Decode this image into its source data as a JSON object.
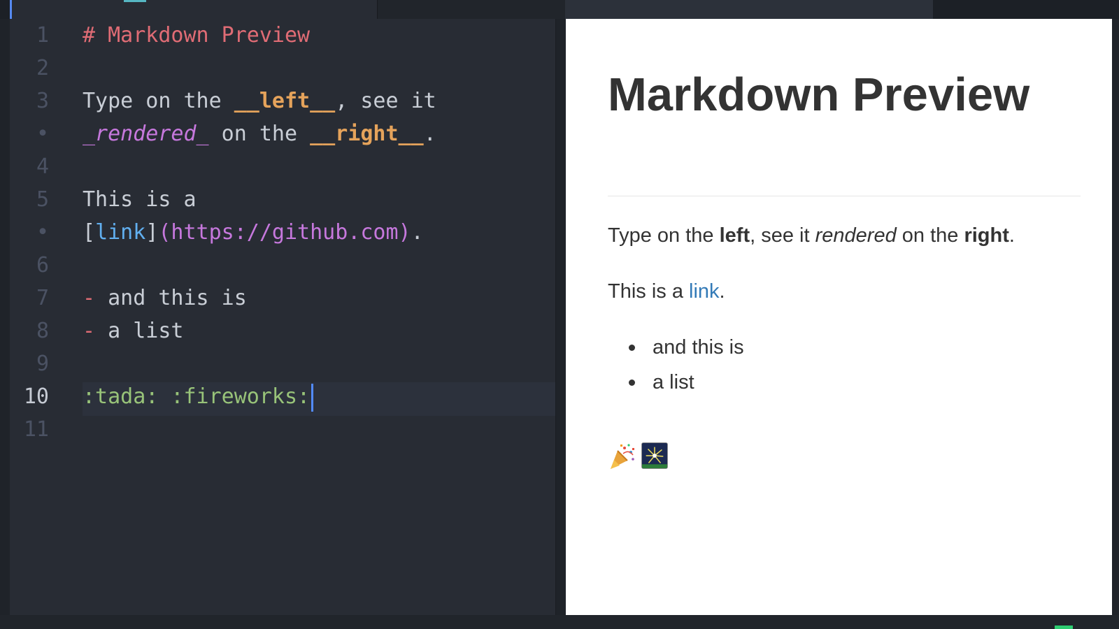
{
  "editor": {
    "lines": [
      {
        "number": "1",
        "text": "# Markdown Preview"
      },
      {
        "number": "2",
        "text": ""
      },
      {
        "number": "3",
        "text_a": "Type on the ",
        "bold_a": "__left__",
        "text_b": ", see it"
      },
      {
        "number": "•",
        "ital": "_rendered_",
        "text_a": " on the ",
        "bold_a": "__right__",
        "text_b": "."
      },
      {
        "number": "4",
        "text": ""
      },
      {
        "number": "5",
        "text": "This is a"
      },
      {
        "number": "•",
        "bracket_open": "[",
        "link_text": "link",
        "bracket_close": "]",
        "url": "(https://github.com)",
        "text_b": "."
      },
      {
        "number": "6",
        "text": ""
      },
      {
        "number": "7",
        "dash": "-",
        "text": " and this is"
      },
      {
        "number": "8",
        "dash": "-",
        "text": " a list"
      },
      {
        "number": "9",
        "text": ""
      },
      {
        "number": "10",
        "emoji_text": ":tada: :fireworks:"
      },
      {
        "number": "11",
        "text": ""
      }
    ]
  },
  "preview": {
    "title": "Markdown Preview",
    "p1": {
      "a": "Type on the ",
      "b": "left",
      "c": ", see it ",
      "d": "rendered",
      "e": " on the ",
      "f": "right",
      "g": "."
    },
    "p2": {
      "a": "This is a ",
      "link": "link",
      "b": "."
    },
    "list": [
      "and this is",
      "a list"
    ],
    "emojis": [
      "tada",
      "fireworks"
    ]
  },
  "colors": {
    "editor_bg": "#282c34",
    "accent": "#528bff",
    "heading": "#e06c75",
    "bold": "#e5a35b",
    "italic": "#c678dd",
    "link": "#61afef",
    "emoji": "#98c379",
    "preview_link": "#337ab7"
  }
}
